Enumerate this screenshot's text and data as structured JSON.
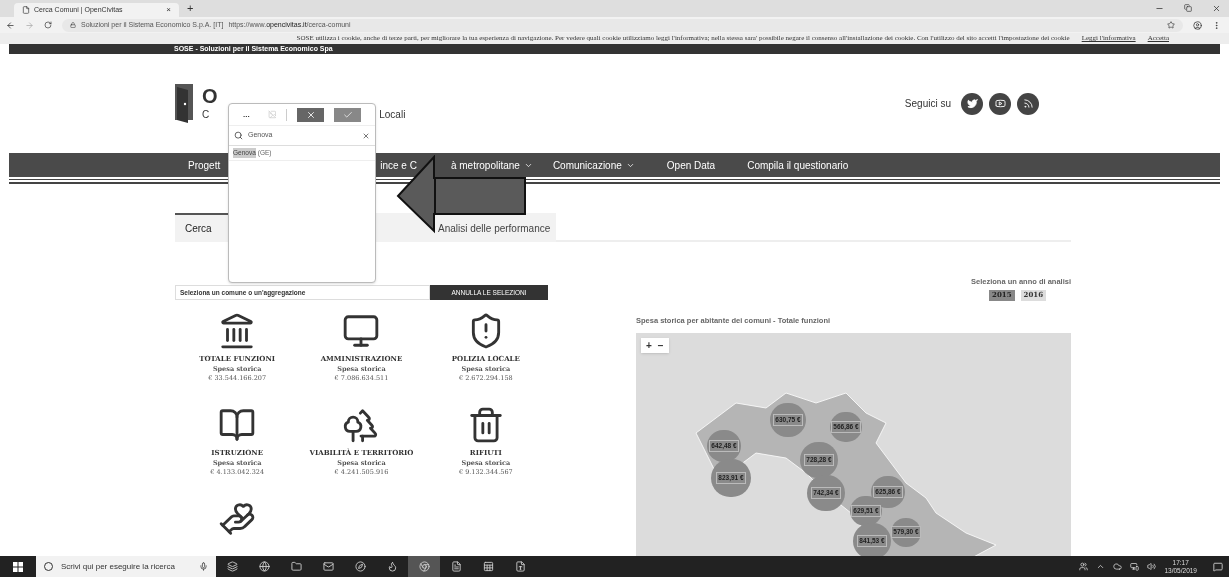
{
  "browser": {
    "tab_title": "Cerca Comuni | OpenCivitas",
    "tab_close": "×",
    "new_tab": "+",
    "site_owner": "Soluzioni per il Sistema Economico S.p.A. [IT]",
    "url_prefix": "https://www.",
    "url_domain": "opencivitas.it",
    "url_path": "/cerca-comuni"
  },
  "cookie_bar": {
    "text": "SOSE utilizza i cookie, anche di terze parti, per migliorare la tua esperienza di navigazione. Per vedere quali cookie utilizziamo leggi l'informativa; nella stessa sara' possibile negare il consenso all'installazione dei cookie. Con l'utilizzo del sito accetti l'impostazione dei cookie",
    "link": "Leggi l'informativa",
    "accept": "Accetta"
  },
  "top_bar": {
    "text": "SOSE - Soluzioni per il Sistema Economico Spa"
  },
  "header": {
    "logo_title": "O",
    "logo_subtitle_start": "C",
    "logo_subtitle_end": "Locali",
    "follow_label": "Seguici su",
    "social": [
      {
        "kind": "twitter"
      },
      {
        "kind": "youtube"
      },
      {
        "kind": "rss"
      }
    ]
  },
  "nav": {
    "items": [
      {
        "label": "Progett",
        "dropdown": false
      },
      {
        "label_start": "ince e C",
        "label": "à metropolitane",
        "dropdown": true
      },
      {
        "label": "Comunicazione",
        "dropdown": true
      },
      {
        "label": "Open Data",
        "dropdown": false
      },
      {
        "label": "Compila il questionario",
        "dropdown": false
      }
    ]
  },
  "tabs": [
    {
      "label": "Cerca",
      "selected": true
    },
    {
      "label": "Analisi delle performance",
      "selected": false
    }
  ],
  "selector": {
    "placeholder": "Seleziona un comune o un'aggregazione",
    "reset_button": "ANNULLA LE SELEZIONI"
  },
  "year_selector": {
    "label": "Seleziona un anno di analisi",
    "years": [
      {
        "label": "2015",
        "selected": true
      },
      {
        "label": "2016",
        "selected": false
      }
    ]
  },
  "categories": [
    {
      "kind": "totale",
      "name": "TOTALE FUNZIONI",
      "label": "Spesa storica",
      "value": "€ 33.544.166.207"
    },
    {
      "kind": "amministrazione",
      "name": "AMMINISTRAZIONE",
      "label": "Spesa storica",
      "value": "€ 7.086.634.511"
    },
    {
      "kind": "polizia",
      "name": "POLIZIA LOCALE",
      "label": "Spesa storica",
      "value": "€ 2.672.294.158"
    },
    {
      "kind": "istruzione",
      "name": "ISTRUZIONE",
      "label": "Spesa storica",
      "value": "€ 4.133.042.324"
    },
    {
      "kind": "viabilita",
      "name": "VIABILITÀ E TERRITORIO",
      "label": "Spesa storica",
      "value": "€ 4.241.505.916"
    },
    {
      "kind": "rifiuti",
      "name": "RIFIUTI",
      "label": "Spesa storica",
      "value": "€ 9.132.344.567"
    },
    {
      "kind": "sociale"
    }
  ],
  "map": {
    "title": "Spesa storica per abitante dei comuni - Totale funzioni",
    "zoom_in": "+",
    "zoom_out": "−",
    "markers": [
      {
        "label": "630,75 €"
      },
      {
        "label": "566,86 €"
      },
      {
        "label": "642,48 €"
      },
      {
        "label": "823,91 €"
      },
      {
        "label": "728,28 €"
      },
      {
        "label": "742,34 €"
      },
      {
        "label": "625,86 €"
      },
      {
        "label": "629,51 €"
      },
      {
        "label": "579,30 €"
      },
      {
        "label": "841,53 €"
      }
    ]
  },
  "popup": {
    "more": "...",
    "query": "Genova",
    "result_match": "Genova",
    "result_rest": "(GE)"
  },
  "taskbar": {
    "search_placeholder": "Scrivi qui per eseguire la ricerca",
    "apps": [
      {
        "kind": "taskview",
        "active": false
      },
      {
        "kind": "edge",
        "active": false
      },
      {
        "kind": "explorer",
        "active": false
      },
      {
        "kind": "outlook",
        "active": false
      },
      {
        "kind": "ie",
        "active": false
      },
      {
        "kind": "firefox",
        "active": false
      },
      {
        "kind": "chrome",
        "active": true
      },
      {
        "kind": "document",
        "active": false
      },
      {
        "kind": "excel",
        "active": false
      },
      {
        "kind": "word",
        "active": false
      }
    ],
    "time": "17:17",
    "date": "13/05/2019"
  }
}
